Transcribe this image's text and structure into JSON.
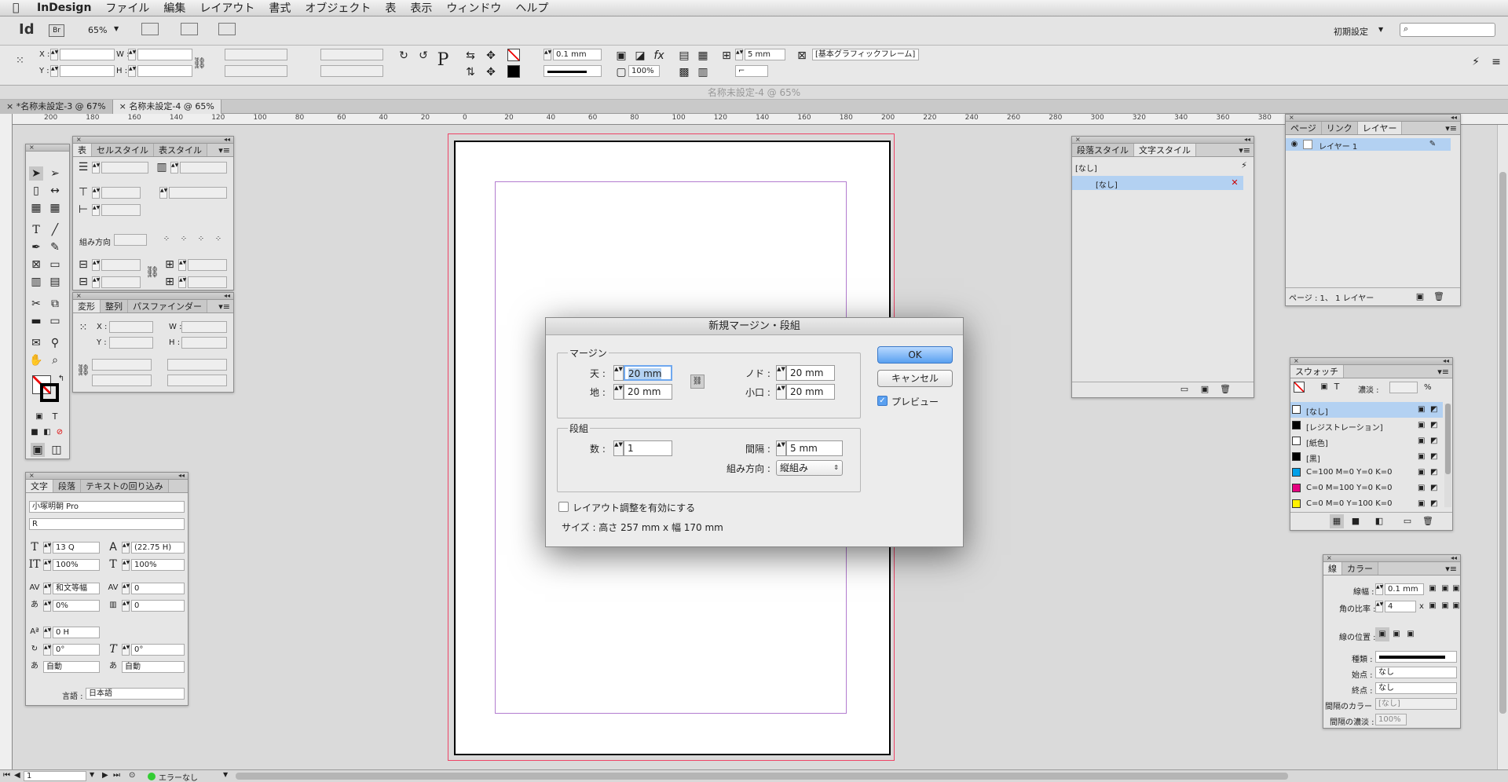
{
  "menubar": {
    "app_name": "InDesign",
    "items": [
      "ファイル",
      "編集",
      "レイアウト",
      "書式",
      "オブジェクト",
      "表",
      "表示",
      "ウィンドウ",
      "ヘルプ"
    ]
  },
  "appbar": {
    "logo": "Id",
    "bridge": "Br",
    "zoom": "65%",
    "workspace": "初期設定"
  },
  "control": {
    "x_label": "X :",
    "y_label": "Y :",
    "w_label": "W :",
    "h_label": "H :",
    "stroke_weight": "0.1 mm",
    "opacity": "100%",
    "gutter": "5 mm",
    "frame_style": "[基本グラフィックフレーム]"
  },
  "document": {
    "title": "名称未設定-4 @ 65%",
    "tabs": [
      "*名称未設定-3 @ 67%",
      "名称未設定-4 @ 65%"
    ]
  },
  "ruler": {
    "labels": [
      "200",
      "180",
      "160",
      "140",
      "120",
      "100",
      "80",
      "60",
      "40",
      "20",
      "0",
      "20",
      "40",
      "60",
      "80",
      "100",
      "120",
      "140",
      "160",
      "180",
      "200",
      "220",
      "240",
      "260",
      "280",
      "300",
      "320",
      "340",
      "360",
      "380"
    ]
  },
  "table_panel": {
    "tabs": [
      "表",
      "セルスタイル",
      "表スタイル"
    ],
    "direction_label": "組み方向 :"
  },
  "transform_panel": {
    "tabs": [
      "変形",
      "整列",
      "パスファインダー"
    ],
    "x_label": "X :",
    "y_label": "Y :",
    "w_label": "W :",
    "h_label": "H :"
  },
  "character_panel": {
    "tabs": [
      "文字",
      "段落",
      "テキストの回り込み"
    ],
    "font": "小塚明朝 Pro",
    "style": "R",
    "size": "13 Q",
    "leading": "(22.75 H)",
    "vscale": "100%",
    "hscale": "100%",
    "kerning": "和文等幅",
    "tracking": "0",
    "tsume": "0%",
    "aki": "0",
    "baseline": "0 H",
    "rotate": "0°",
    "skew": "0°",
    "auto1": "自動",
    "auto2": "自動",
    "lang_label": "言語 :",
    "lang": "日本語"
  },
  "styles_panel": {
    "tabs": [
      "段落スタイル",
      "文字スタイル"
    ],
    "current": "[なし]",
    "item": "[なし]"
  },
  "layers_panel": {
    "tabs": [
      "ページ",
      "リンク",
      "レイヤー"
    ],
    "layer": "レイヤー 1",
    "footer": "ページ : 1、 1 レイヤー"
  },
  "swatches_panel": {
    "title": "スウォッチ",
    "tint_label": "濃淡 :",
    "percent": "%",
    "items": [
      {
        "name": "[なし]",
        "color": "#ffffff"
      },
      {
        "name": "[レジストレーション]",
        "color": "#000000"
      },
      {
        "name": "[紙色]",
        "color": "#ffffff"
      },
      {
        "name": "[黒]",
        "color": "#000000"
      },
      {
        "name": "C=100 M=0 Y=0 K=0",
        "color": "#00a0e9"
      },
      {
        "name": "C=0 M=100 Y=0 K=0",
        "color": "#e4007f"
      },
      {
        "name": "C=0 M=0 Y=100 K=0",
        "color": "#fff100"
      }
    ]
  },
  "stroke_panel": {
    "tabs": [
      "線",
      "カラー"
    ],
    "weight_label": "線幅 :",
    "weight": "0.1 mm",
    "miter_label": "角の比率 :",
    "miter": "4",
    "miter_x": "x",
    "align_label": "線の位置 :",
    "type_label": "種類 :",
    "start_label": "始点 :",
    "start": "なし",
    "end_label": "終点 :",
    "end": "なし",
    "gap_label": "間隔のカラー :",
    "gap": "[なし]",
    "gap_tint_label": "間隔の濃淡 :",
    "gap_tint": "100%"
  },
  "dialog": {
    "title": "新規マージン・段組",
    "margin_group": "マージン",
    "top_label": "天 :",
    "top": "20 mm",
    "bottom_label": "地 :",
    "bottom": "20 mm",
    "inside_label": "ノド :",
    "inside": "20 mm",
    "outside_label": "小口 :",
    "outside": "20 mm",
    "columns_group": "段組",
    "count_label": "数 :",
    "count": "1",
    "gutter_label": "間隔 :",
    "gutter": "5 mm",
    "direction_label": "組み方向 :",
    "direction": "縦組み",
    "ok": "OK",
    "cancel": "キャンセル",
    "preview": "プレビュー",
    "adjust_layout": "レイアウト調整を有効にする",
    "size_info": "サイズ : 高さ 257 mm x 幅 170 mm"
  },
  "status": {
    "page": "1",
    "error": "エラーなし"
  }
}
